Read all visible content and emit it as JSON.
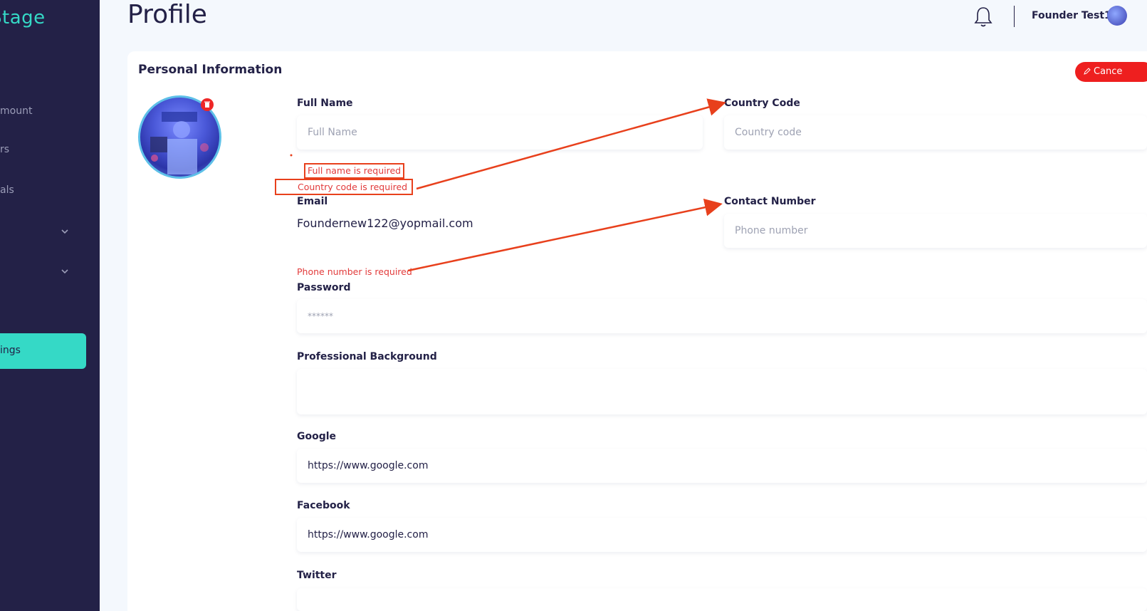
{
  "sidebar": {
    "logo": "Stage",
    "items": [
      {
        "label": "mount"
      },
      {
        "label": "rs"
      },
      {
        "label": "als"
      },
      {
        "label": ""
      },
      {
        "label": ""
      },
      {
        "label": "ings"
      }
    ]
  },
  "header": {
    "page_title": "Profile",
    "user_name": "Founder Test11"
  },
  "card": {
    "title": "Personal Information",
    "cancel_label": "Cance"
  },
  "form": {
    "full_name": {
      "label": "Full Name",
      "placeholder": "Full Name",
      "error": "Full name is required"
    },
    "country_code": {
      "label": "Country Code",
      "placeholder": "Country code",
      "error": "Country code is required"
    },
    "email": {
      "label": "Email",
      "value": "Foundernew122@yopmail.com"
    },
    "contact_number": {
      "label": "Contact Number",
      "placeholder": "Phone number",
      "error": "Phone number is required"
    },
    "password": {
      "label": "Password",
      "value": "******"
    },
    "professional_background": {
      "label": "Professional Background",
      "value": ""
    },
    "google": {
      "label": "Google",
      "value": "https://www.google.com"
    },
    "facebook": {
      "label": "Facebook",
      "value": "https://www.google.com"
    },
    "twitter": {
      "label": "Twitter"
    }
  },
  "colors": {
    "sidebar_bg": "#232147",
    "accent": "#35d9c6",
    "error": "#e23a3a",
    "annotation": "#e8401c",
    "cancel_bg": "#ee1f1f"
  }
}
